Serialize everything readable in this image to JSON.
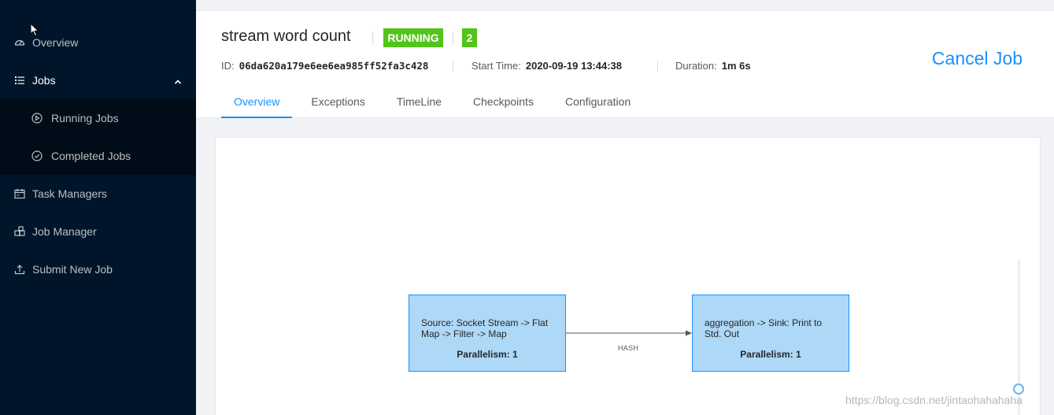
{
  "sidebar": {
    "items": [
      {
        "label": "Overview",
        "icon": "dashboard-icon"
      },
      {
        "label": "Jobs",
        "icon": "list-icon",
        "expanded": true
      },
      {
        "label": "Task Managers",
        "icon": "schedule-icon"
      },
      {
        "label": "Job Manager",
        "icon": "build-icon"
      },
      {
        "label": "Submit New Job",
        "icon": "upload-icon"
      }
    ],
    "jobs_submenu": [
      {
        "label": "Running Jobs",
        "icon": "play-circle-icon"
      },
      {
        "label": "Completed Jobs",
        "icon": "check-circle-icon"
      }
    ]
  },
  "header": {
    "title": "stream word count",
    "status": "RUNNING",
    "count": "2",
    "id_label": "ID:",
    "id_value": "06da620a179e6ee6ea985ff52fa3c428",
    "start_label": "Start Time:",
    "start_value": "2020-09-19 13:44:38",
    "duration_label": "Duration:",
    "duration_value": "1m 6s",
    "cancel_label": "Cancel Job",
    "tabs": [
      "Overview",
      "Exceptions",
      "TimeLine",
      "Checkpoints",
      "Configuration"
    ],
    "active_tab": "Overview"
  },
  "graph": {
    "nodes": [
      {
        "label": "Source: Socket Stream -> Flat Map -> Filter -> Map",
        "parallelism": "Parallelism: 1"
      },
      {
        "label": "aggregation -> Sink: Print to Std. Out",
        "parallelism": "Parallelism: 1"
      }
    ],
    "edge_label": "HASH"
  },
  "watermark": "https://blog.csdn.net/jintaohahahaha",
  "colors": {
    "sidebar_bg": "#001529",
    "submenu_bg": "#000c17",
    "accent": "#1890ff",
    "status_green": "#52c41a",
    "node_fill": "#add8f7"
  }
}
